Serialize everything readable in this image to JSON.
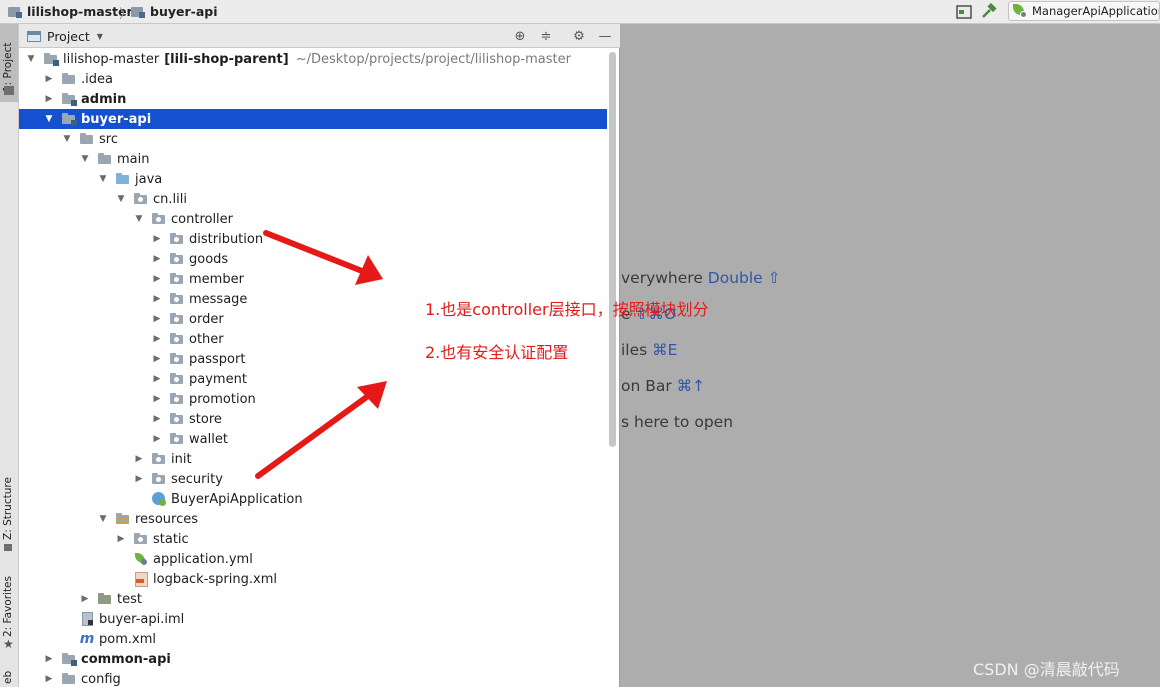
{
  "breadcrumb": [
    "lilishop-master",
    "buyer-api"
  ],
  "run_config": "ManagerApiApplication",
  "stripe": {
    "project_tab": "1: Project",
    "structure_tab": "Z: Structure",
    "favorites_tab": "2: Favorites",
    "web_tab": "eb"
  },
  "panel": {
    "title": "Project"
  },
  "tree": [
    {
      "label": "lilishop-master",
      "bold_suffix": "[lili-shop-parent]",
      "path": "~/Desktop/projects/project/lilishop-master",
      "depth": 0,
      "expanded": true,
      "icon": "module"
    },
    {
      "label": ".idea",
      "depth": 1,
      "expanded": false,
      "icon": "folder"
    },
    {
      "label": "admin",
      "depth": 1,
      "expanded": false,
      "icon": "module",
      "bold": true
    },
    {
      "label": "buyer-api",
      "depth": 1,
      "expanded": true,
      "icon": "module",
      "bold": true,
      "selected": true
    },
    {
      "label": "src",
      "depth": 2,
      "expanded": true,
      "icon": "folder"
    },
    {
      "label": "main",
      "depth": 3,
      "expanded": true,
      "icon": "folder"
    },
    {
      "label": "java",
      "depth": 4,
      "expanded": true,
      "icon": "source"
    },
    {
      "label": "cn.lili",
      "depth": 5,
      "expanded": true,
      "icon": "package"
    },
    {
      "label": "controller",
      "depth": 6,
      "expanded": true,
      "icon": "package"
    },
    {
      "label": "distribution",
      "depth": 7,
      "expanded": false,
      "icon": "package"
    },
    {
      "label": "goods",
      "depth": 7,
      "expanded": false,
      "icon": "package"
    },
    {
      "label": "member",
      "depth": 7,
      "expanded": false,
      "icon": "package"
    },
    {
      "label": "message",
      "depth": 7,
      "expanded": false,
      "icon": "package"
    },
    {
      "label": "order",
      "depth": 7,
      "expanded": false,
      "icon": "package"
    },
    {
      "label": "other",
      "depth": 7,
      "expanded": false,
      "icon": "package"
    },
    {
      "label": "passport",
      "depth": 7,
      "expanded": false,
      "icon": "package"
    },
    {
      "label": "payment",
      "depth": 7,
      "expanded": false,
      "icon": "package"
    },
    {
      "label": "promotion",
      "depth": 7,
      "expanded": false,
      "icon": "package"
    },
    {
      "label": "store",
      "depth": 7,
      "expanded": false,
      "icon": "package"
    },
    {
      "label": "wallet",
      "depth": 7,
      "expanded": false,
      "icon": "package"
    },
    {
      "label": "init",
      "depth": 6,
      "expanded": false,
      "icon": "package"
    },
    {
      "label": "security",
      "depth": 6,
      "expanded": false,
      "icon": "package"
    },
    {
      "label": "BuyerApiApplication",
      "depth": 6,
      "leaf": true,
      "icon": "javaapp"
    },
    {
      "label": "resources",
      "depth": 4,
      "expanded": true,
      "icon": "resources"
    },
    {
      "label": "static",
      "depth": 5,
      "expanded": false,
      "icon": "package"
    },
    {
      "label": "application.yml",
      "depth": 5,
      "leaf": true,
      "icon": "yml"
    },
    {
      "label": "logback-spring.xml",
      "depth": 5,
      "leaf": true,
      "icon": "xml"
    },
    {
      "label": "test",
      "depth": 3,
      "expanded": false,
      "icon": "test"
    },
    {
      "label": "buyer-api.iml",
      "depth": 2,
      "leaf": true,
      "icon": "iml"
    },
    {
      "label": "pom.xml",
      "depth": 2,
      "leaf": true,
      "icon": "pom"
    },
    {
      "label": "common-api",
      "depth": 1,
      "expanded": false,
      "icon": "module",
      "bold": true
    },
    {
      "label": "config",
      "depth": 1,
      "expanded": false,
      "icon": "folder"
    }
  ],
  "editor_hints": [
    {
      "text": "verywhere ",
      "kbd": "Double ⇧"
    },
    {
      "text": "e ",
      "kbd": "⇧⌘O"
    },
    {
      "text": "iles ",
      "kbd": "⌘E"
    },
    {
      "text": "on Bar ",
      "kbd": "⌘↑"
    },
    {
      "text": "s here to open",
      "kbd": ""
    }
  ],
  "annotations": {
    "note1": "1.也是controller层接口，按照模块划分",
    "note2": "2.也有安全认证配置"
  },
  "watermark": "CSDN @清晨敲代码",
  "colors": {
    "selection": "#1450cf",
    "annotation": "#e61919",
    "editor_bg": "#adadad"
  }
}
